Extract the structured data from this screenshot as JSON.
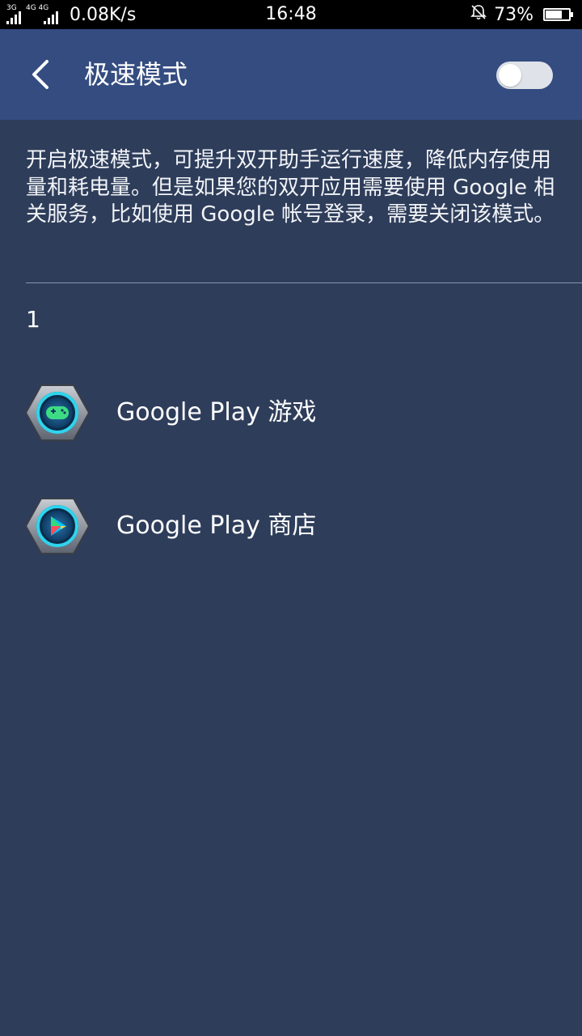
{
  "status_bar": {
    "sim1_label": "3G",
    "sim2_label": "4G 4G",
    "net_speed": "0.08K/s",
    "time": "16:48",
    "battery_percent": "73%",
    "battery_level": 0.73,
    "icons": [
      "signal-icon",
      "signal-icon",
      "bell-muted-icon",
      "battery-icon"
    ]
  },
  "header": {
    "title": "极速模式",
    "back_icon": "chevron-left-icon",
    "toggle_on": false
  },
  "description": "开启极速模式，可提升双开助手运行速度，降低内存使用量和耗电量。但是如果您的双开应用需要使用 Google 相关服务，比如使用 Google 帐号登录，需要关闭该模式。",
  "count": "1",
  "apps": [
    {
      "name": "Google Play 游戏",
      "icon": "gamepad-icon"
    },
    {
      "name": "Google Play 商店",
      "icon": "play-store-icon"
    }
  ],
  "colors": {
    "background": "#2e3d5a",
    "app_bar": "#344c80",
    "status_bar": "#000000",
    "icon_ring": "#2fd4ec",
    "icon_frame": "#9aa2ad"
  }
}
